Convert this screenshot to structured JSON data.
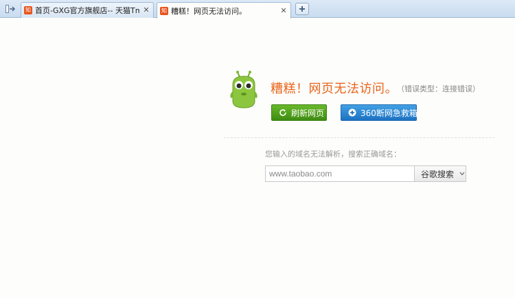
{
  "tabs": [
    {
      "title": "首页-GXG官方旗舰店-- 天猫Tmall.c...",
      "favicon": "知",
      "active": false
    },
    {
      "title": "糟糕！网页无法访问。",
      "favicon": "知",
      "active": true
    }
  ],
  "error": {
    "title": "糟糕！网页无法访问。",
    "type_text": "（错误类型：连接错误）"
  },
  "buttons": {
    "refresh_label": "刷新网页",
    "rescue_label": "360断网急救箱"
  },
  "search": {
    "hint": "您输入的域名无法解析，搜索正确域名：",
    "value": "www.taobao.com",
    "button_label": "谷歌搜索"
  },
  "colors": {
    "accent_orange": "#e8641b",
    "refresh_green": "#4a9b1a",
    "rescue_blue": "#2a84d2"
  }
}
